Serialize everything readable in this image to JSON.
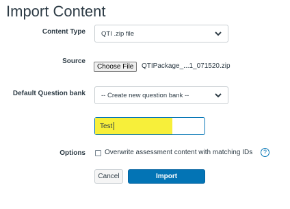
{
  "page": {
    "title": "Import Content"
  },
  "form": {
    "content_type": {
      "label": "Content Type",
      "value": "QTI .zip file"
    },
    "source": {
      "label": "Source",
      "button_label": "Choose File",
      "file_name": "QTIPackage_...1_071520.zip"
    },
    "question_bank": {
      "label": "Default Question bank",
      "value": "-- Create new question bank --",
      "new_bank_name": "Test"
    },
    "options": {
      "label": "Options",
      "overwrite_label": "Overwrite assessment content with matching IDs",
      "overwrite_checked": false,
      "help_glyph": "?"
    }
  },
  "actions": {
    "cancel_label": "Cancel",
    "import_label": "Import"
  },
  "colors": {
    "highlight": "#f7ef3a",
    "primary": "#0374b5",
    "text": "#2d3b45"
  },
  "icons": {
    "select_arrow": "chevron-down-icon",
    "help": "help-circle-icon"
  }
}
